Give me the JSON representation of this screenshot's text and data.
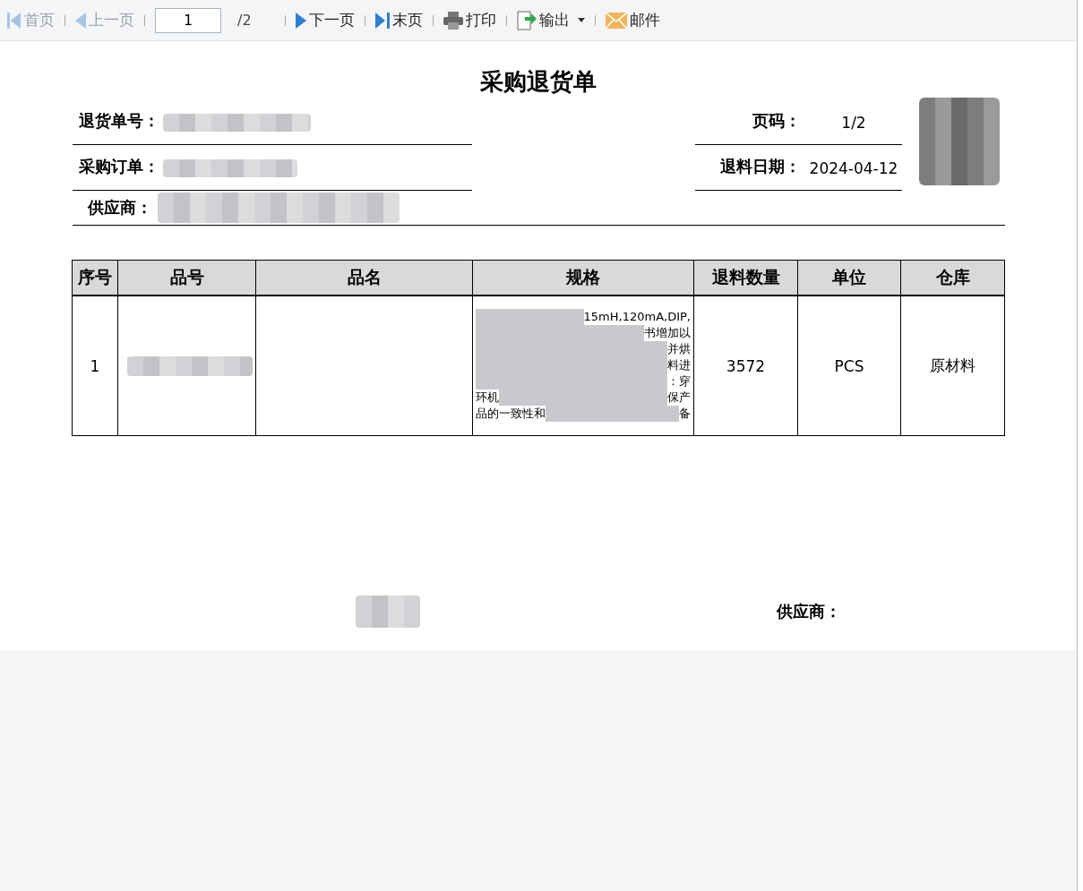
{
  "toolbar": {
    "items": [
      {
        "kind": "first",
        "label": "首页",
        "disabled": true
      },
      {
        "kind": "prev",
        "label": "上一页",
        "disabled": true
      },
      {
        "kind": "page",
        "value": "1",
        "total": "/2"
      },
      {
        "kind": "next",
        "label": "下一页",
        "disabled": false
      },
      {
        "kind": "last",
        "label": "末页",
        "disabled": false
      },
      {
        "kind": "print",
        "label": "打印",
        "disabled": false
      },
      {
        "kind": "export",
        "label": "输出",
        "disabled": false
      },
      {
        "kind": "mail",
        "label": "邮件",
        "disabled": false
      }
    ]
  },
  "report": {
    "title": "采购退货单",
    "left_fields": [
      {
        "label": "退货单号："
      },
      {
        "label": "采购订单："
      }
    ],
    "right_fields": [
      {
        "label": "页码：",
        "value": "1/2"
      },
      {
        "label": "退料日期：",
        "value": "2024-04-12"
      }
    ],
    "supplier_label": "供应商：",
    "table": {
      "columns": [
        "序号",
        "品号",
        "品名",
        "规格",
        "退料数量",
        "单位",
        "仓库"
      ],
      "rows": [
        {
          "no": "1",
          "qty": "3572",
          "unit": "PCS",
          "warehouse": "原材料",
          "spec_lines": [
            {
              "right": "15mH,120mA,DIP,"
            },
            {
              "right": "书增加以"
            },
            {
              "right": "并烘"
            },
            {
              "right": "料进"
            },
            {
              "right": "：穿"
            },
            {
              "left": "环机",
              "right": "保产"
            },
            {
              "left": "品的一致性和",
              "right": "备"
            }
          ]
        }
      ]
    },
    "footer": {
      "supplier_label": "供应商："
    }
  }
}
